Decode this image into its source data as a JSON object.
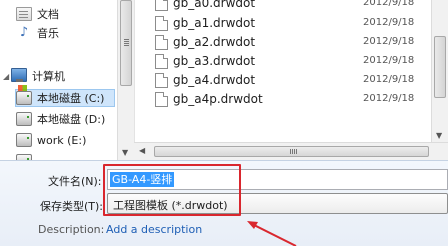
{
  "nav": {
    "items": [
      {
        "label": "文档",
        "icon": "documents-icon"
      },
      {
        "label": "音乐",
        "icon": "music-icon"
      },
      {
        "label": "计算机",
        "icon": "computer-icon"
      },
      {
        "label": "本地磁盘 (C:)",
        "icon": "drive-icon"
      },
      {
        "label": "本地磁盘 (D:)",
        "icon": "drive-icon"
      },
      {
        "label": "work (E:)",
        "icon": "drive-icon"
      }
    ]
  },
  "files": [
    {
      "name": "gb_a0.drwdot",
      "date": "2012/9/18"
    },
    {
      "name": "gb_a1.drwdot",
      "date": "2012/9/18"
    },
    {
      "name": "gb_a2.drwdot",
      "date": "2012/9/18"
    },
    {
      "name": "gb_a3.drwdot",
      "date": "2012/9/18"
    },
    {
      "name": "gb_a4.drwdot",
      "date": "2012/9/18"
    },
    {
      "name": "gb_a4p.drwdot",
      "date": "2012/9/18"
    }
  ],
  "form": {
    "filename_label": "文件名(N):",
    "filename_value": "GB-A4-竖排",
    "filetype_label": "保存类型(T):",
    "filetype_value": "工程图模板 (*.drwdot)",
    "description_label": "Description:",
    "description_link": "Add a description"
  },
  "annotation": {
    "color": "#d9272e"
  }
}
